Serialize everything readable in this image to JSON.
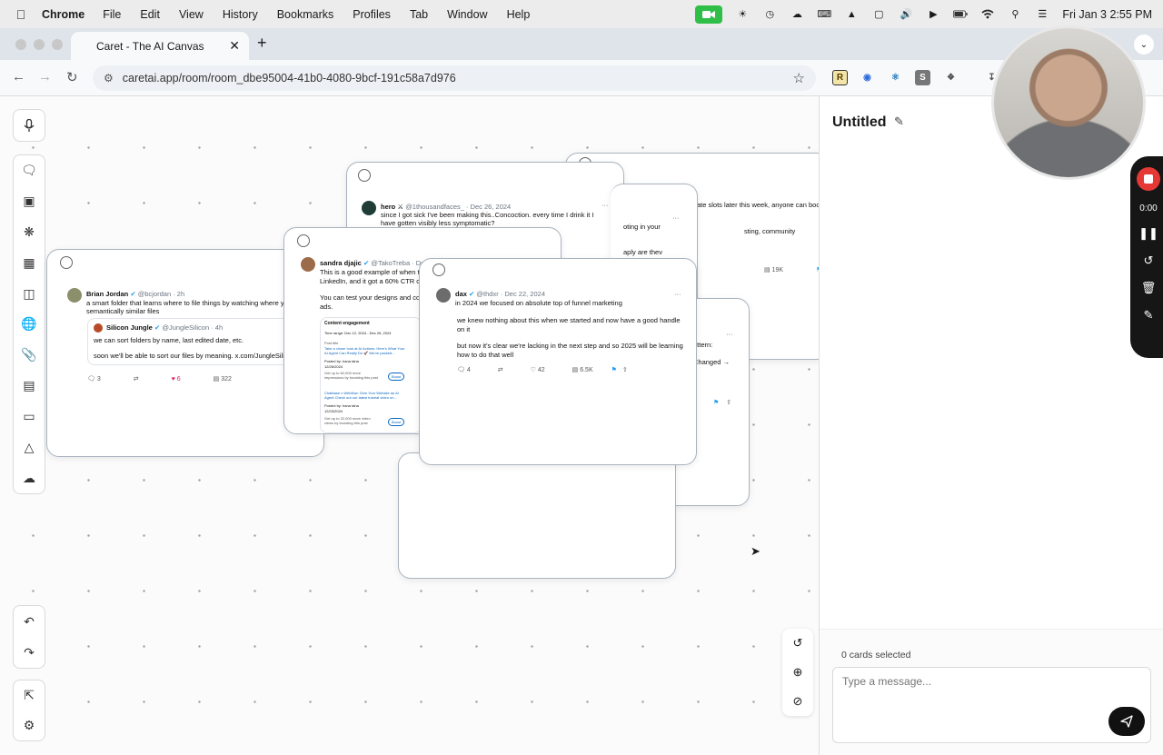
{
  "menubar": {
    "app_name": "Chrome",
    "items": [
      "File",
      "Edit",
      "View",
      "History",
      "Bookmarks",
      "Profiles",
      "Tab",
      "Window",
      "Help"
    ],
    "clock": "Fri Jan 3  2:55 PM"
  },
  "browser": {
    "tab_title": "Caret - The AI Canvas",
    "url": "caretai.app/room/room_dbe95004-41b0-4080-9bcf-191c58a7d976",
    "extensions": [
      "R",
      "S"
    ]
  },
  "canvas": {
    "cards": [
      {
        "id": "brian",
        "tweet": {
          "name": "Brian Jordan",
          "handle": "@bcjordan · 2h",
          "lines": [
            "a smart folder that learns where to file things by watching where you",
            "semantically similar files"
          ],
          "quote": {
            "name": "Silicon Jungle",
            "handle": "@JungleSilicon · 4h",
            "lines": [
              "we can sort folders by name, last edited date, etc.",
              "soon we'll be able to sort our files by meaning. x.com/JungleSilicon..."
            ]
          },
          "replies": "3",
          "likes": "6",
          "views": "322"
        }
      },
      {
        "id": "hero",
        "tweet": {
          "name": "hero",
          "handle": "@1thousandfaces_ · Dec 26, 2024",
          "lines": [
            "since I got sick I've been making this..Concoction. every time I drink it I",
            "have gotten visibly less symptomatic?"
          ]
        }
      },
      {
        "id": "sandra",
        "tweet": {
          "name": "sandra djajic",
          "handle": "@TakoTreba · Dec",
          "lines": [
            "This is a good example of when to",
            "LinkedIn, and it got a 60% CTR on",
            "You can test your designs and cop",
            "ads."
          ],
          "panel_title": "Content engagement",
          "time_range": "Time range:  Dec 12, 2024 - Dec 26, 2024",
          "post_title_label": "Post title",
          "posts": [
            {
              "title": "Take a closer look at AI Actions: Here's What Your AI Agent Can Really Do 🚀 We've packed...",
              "meta": "Posted by: hana taha",
              "date": "12/26/2024",
              "boost_text": "Get up to 62,000 more impressions by boosting this post",
              "boost": "Boost"
            },
            {
              "title": "Chatbase x Webflow: Give Your Website an AI Agent Check out our latest tutorial video on...",
              "meta": "Posted by: hana taha",
              "date": "12/23/2024",
              "boost_text": "Get up to 22,000 more video views by boosting this post",
              "boost": "Boost"
            }
          ]
        }
      },
      {
        "id": "dax",
        "tweet": {
          "name": "dax",
          "handle": "@thdxr · Dec 22, 2024",
          "lines": [
            "in 2024 we focused on absolute top of funnel marketing",
            "we knew nothing about this when we started and now have a good handle",
            "on it",
            "but now it's clear we're lacking in the next step and so 2025 will be learning",
            "how to do that well"
          ],
          "replies": "4",
          "likes": "42",
          "views": "6.5K"
        }
      },
      {
        "id": "back-right",
        "tweet": {
          "lines": [
            "ate slots later this week, anyone can book",
            "sting, community"
          ],
          "views": "19K"
        }
      },
      {
        "id": "mid-right",
        "tweet": {
          "lines": [
            "oting in your",
            "aply are thev"
          ]
        }
      },
      {
        "id": "lower-right",
        "tweet": {
          "lines": [
            "attern:",
            "Changed →"
          ]
        }
      }
    ]
  },
  "panel": {
    "title": "Untitled",
    "cards_selected": "0 cards selected",
    "message_placeholder": "Type a message..."
  },
  "recorder": {
    "time": "0:00"
  },
  "colors": {
    "verified": "#1d9bf0",
    "like": "#e0245e",
    "record": "#e53935",
    "facetime": "#2fbf48"
  }
}
